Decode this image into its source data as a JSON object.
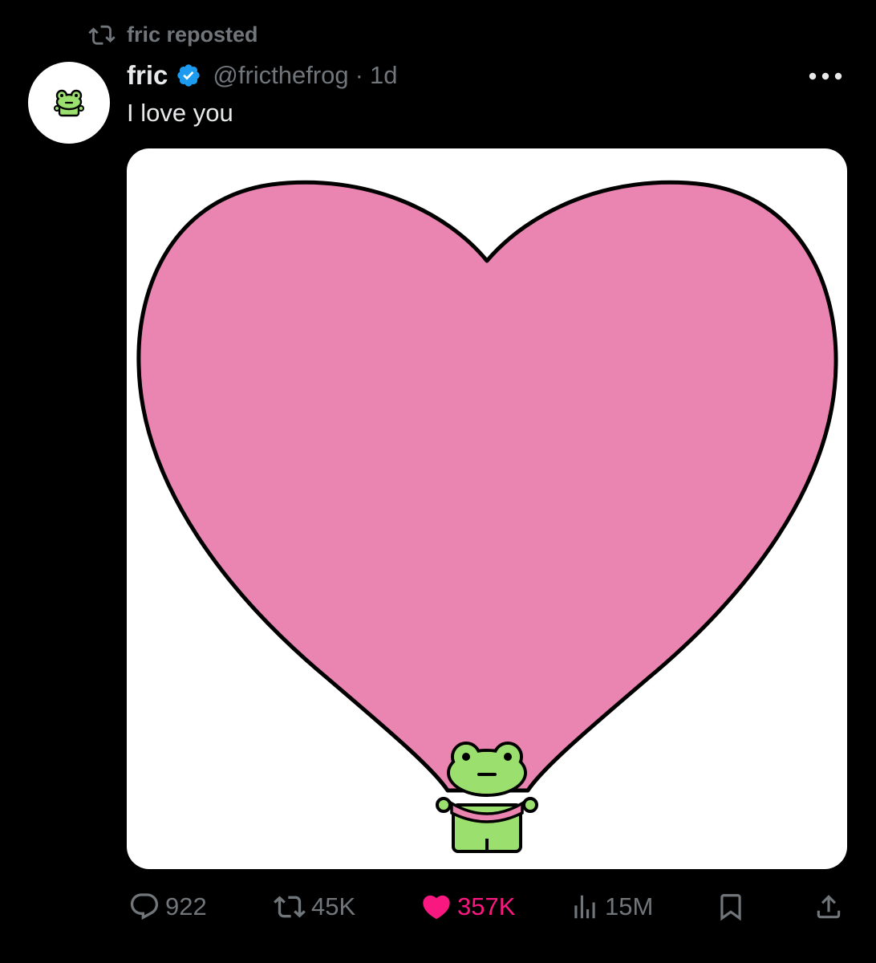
{
  "context": {
    "icon": "repost-icon",
    "label": "fric reposted"
  },
  "author": {
    "display_name": "fric",
    "verified": true,
    "verified_color": "#1d9bf0",
    "handle": "@fricthefrog",
    "separator": "·",
    "time": "1d",
    "avatar_icon": "frog-avatar-icon"
  },
  "tweet": {
    "text": "I love you",
    "media_description_icon": "heart-frog-illustration"
  },
  "actions": {
    "reply": {
      "icon": "reply-icon",
      "count": "922"
    },
    "repost": {
      "icon": "repost-icon",
      "count": "45K"
    },
    "like": {
      "icon": "heart-icon",
      "count": "357K",
      "liked": true,
      "color": "#f91880"
    },
    "views": {
      "icon": "analytics-icon",
      "count": "15M"
    },
    "bookmark": {
      "icon": "bookmark-icon"
    },
    "share": {
      "icon": "share-icon"
    }
  },
  "colors": {
    "background": "#000000",
    "secondary_text": "#71767b",
    "primary_text": "#e7e9ea",
    "heart_pink": "#e985b0",
    "frog_green": "#9be06e"
  }
}
